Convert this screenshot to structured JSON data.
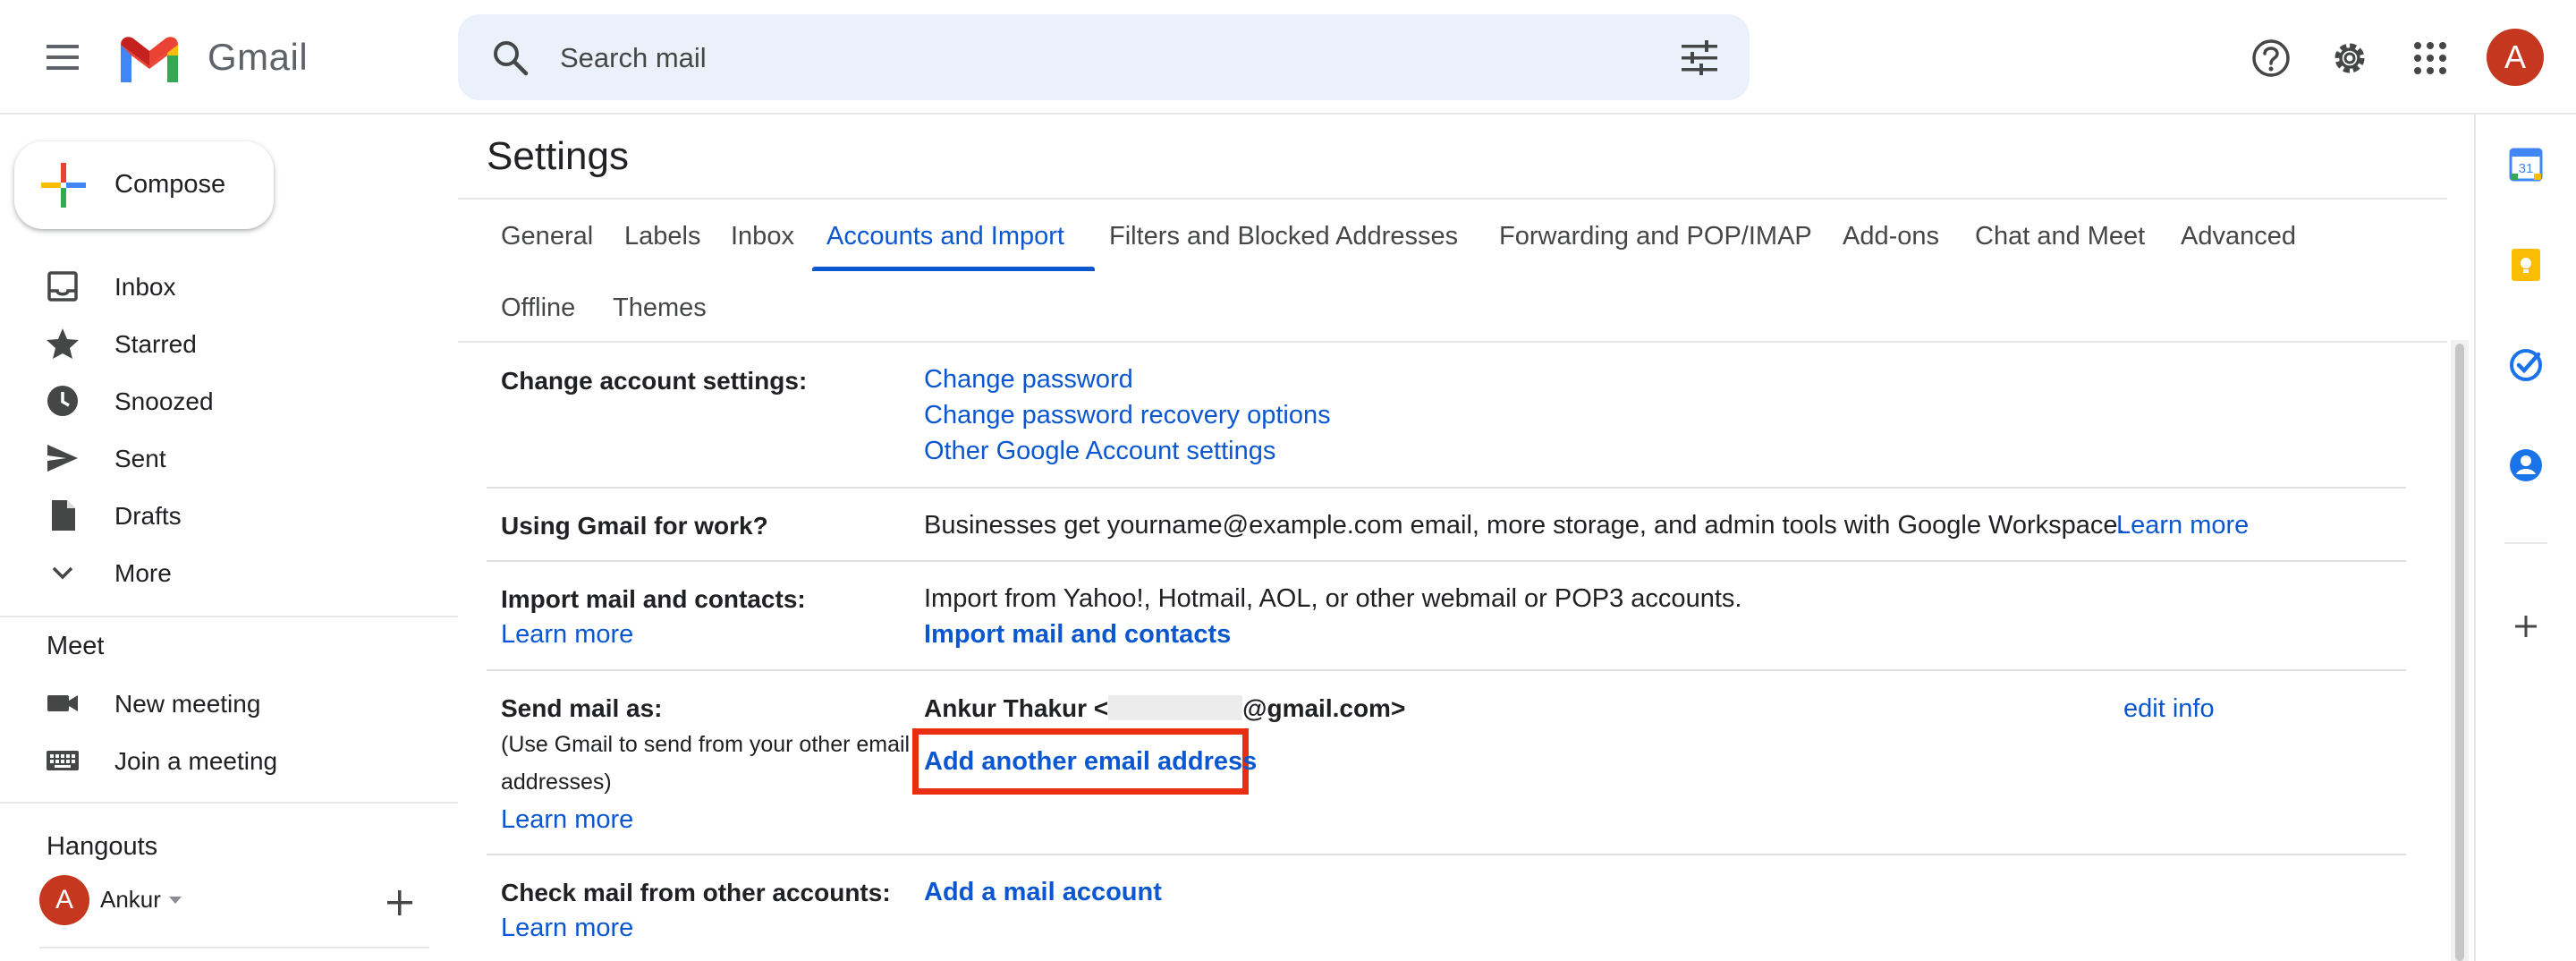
{
  "header": {
    "app_name": "Gmail",
    "search_placeholder": "Search mail",
    "avatar_letter": "A"
  },
  "nav": {
    "compose_label": "Compose",
    "items": [
      {
        "label": "Inbox",
        "icon": "inbox-icon"
      },
      {
        "label": "Starred",
        "icon": "star-icon"
      },
      {
        "label": "Snoozed",
        "icon": "clock-icon"
      },
      {
        "label": "Sent",
        "icon": "send-icon"
      },
      {
        "label": "Drafts",
        "icon": "draft-icon"
      },
      {
        "label": "More",
        "icon": "chevron-down-icon"
      }
    ],
    "meet_title": "Meet",
    "meet_items": [
      {
        "label": "New meeting",
        "icon": "video-camera-icon"
      },
      {
        "label": "Join a meeting",
        "icon": "keyboard-icon"
      }
    ],
    "hangouts_title": "Hangouts",
    "hangouts_user": "Ankur",
    "hangouts_avatar_letter": "A"
  },
  "settings": {
    "title": "Settings",
    "tabs": [
      "General",
      "Labels",
      "Inbox",
      "Accounts and Import",
      "Filters and Blocked Addresses",
      "Forwarding and POP/IMAP",
      "Add-ons",
      "Chat and Meet",
      "Advanced",
      "Offline",
      "Themes"
    ],
    "active_tab": "Accounts and Import",
    "rows": {
      "change_account": {
        "label": "Change account settings:",
        "links": [
          "Change password",
          "Change password recovery options",
          "Other Google Account settings"
        ]
      },
      "gmail_for_work": {
        "label": "Using Gmail for work?",
        "text": "Businesses get yourname@example.com email, more storage, and admin tools with Google Workspace.",
        "link": "Learn more"
      },
      "import_mail": {
        "label": "Import mail and contacts:",
        "learn_more": "Learn more",
        "text": "Import from Yahoo!, Hotmail, AOL, or other webmail or POP3 accounts.",
        "action": "Import mail and contacts"
      },
      "send_mail_as": {
        "label": "Send mail as:",
        "sub_line1": "(Use Gmail to send from your other email",
        "sub_line2": "addresses)",
        "learn_more": "Learn more",
        "identity_prefix": "Ankur Thakur <",
        "identity_suffix": "@gmail.com>",
        "edit_info": "edit info",
        "add_address": "Add another email address"
      },
      "check_mail": {
        "label": "Check mail from other accounts:",
        "learn_more": "Learn more",
        "action": "Add a mail account"
      }
    }
  },
  "colors": {
    "link": "#0b57d0",
    "highlight": "#ea2e12",
    "avatar": "#c5381f",
    "search_bg": "#eaf1fb"
  }
}
